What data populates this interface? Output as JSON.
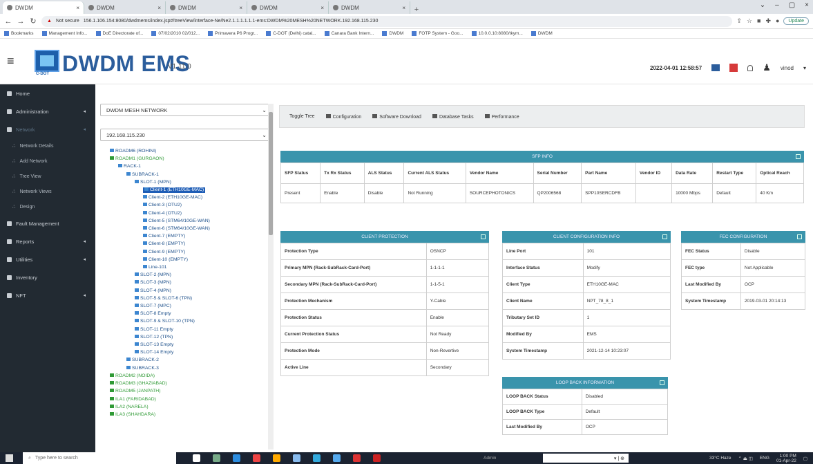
{
  "browser": {
    "tabs": [
      {
        "label": "DWDM",
        "active": true
      },
      {
        "label": "DWDM",
        "active": false
      },
      {
        "label": "DWDM",
        "active": false
      },
      {
        "label": "DWDM",
        "active": false
      },
      {
        "label": "DWDM",
        "active": false
      }
    ],
    "new_tab": "+",
    "address": {
      "security": "Not secure",
      "url": "156.1.106.154:8080/dwdmems/index.jsp#/treeView/interface-Ne/Ne2.1.1.1.1.1.1-ems:DWDM%20MESH%20NETWORK.192.168.115.230"
    },
    "update_label": "Update",
    "bookmarks": [
      "Bookmarks",
      "Management Info...",
      "DoE Directorate of...",
      "07/02/2010 02/012...",
      "Primavera P6 Progr...",
      "C-DOT (Delhi) catal...",
      "Canara Bank Intern...",
      "DWDM",
      "FOTP System - Goo...",
      "10.0.0.10:8080/tkym...",
      "DWDM"
    ]
  },
  "header": {
    "logo_text": "C-DOT",
    "brand": "DWDM EMS",
    "version": "V1.11.0",
    "datetime": "2022-04-01 12:58:57",
    "user": "vinod"
  },
  "sidebar": {
    "items": [
      {
        "label": "Home",
        "icon": "home-icon",
        "caret": false
      },
      {
        "label": "Administration",
        "icon": "admin-icon",
        "caret": true
      },
      {
        "label": "Network",
        "icon": "network-icon",
        "caret": true,
        "dim": true
      },
      {
        "label": "Network Details",
        "sub": true
      },
      {
        "label": "Add Network",
        "sub": true
      },
      {
        "label": "Tree View",
        "sub": true
      },
      {
        "label": "Network Views",
        "sub": true
      },
      {
        "label": "Design",
        "sub": true
      },
      {
        "label": "Fault Management",
        "icon": "bell-icon",
        "caret": false
      },
      {
        "label": "Reports",
        "icon": "reports-icon",
        "caret": true
      },
      {
        "label": "Utilities",
        "icon": "utilities-icon",
        "caret": true
      },
      {
        "label": "Inventory",
        "icon": "inventory-icon",
        "caret": false
      },
      {
        "label": "NFT",
        "icon": "nft-icon",
        "caret": true
      }
    ]
  },
  "tree_pane": {
    "network_select": "DWDM MESH NETWORK",
    "ip_select": "192.168.115.230",
    "nodes": [
      {
        "label": "ROADM6 (ROHINI)",
        "level": 0,
        "green": false
      },
      {
        "label": "ROADM1 (GURGAON)",
        "level": 0,
        "green": true
      },
      {
        "label": "RACK-1",
        "level": 1
      },
      {
        "label": "SUBRACK-1",
        "level": 2
      },
      {
        "label": "SLOT-1 (MPN)",
        "level": 3
      },
      {
        "label": "Client-1 (ETH10GE-MAC)",
        "level": 4,
        "selected": true
      },
      {
        "label": "Client-2 (ETH10GE-MAC)",
        "level": 4
      },
      {
        "label": "Client-3 (OTU2)",
        "level": 4
      },
      {
        "label": "Client-4 (OTU2)",
        "level": 4
      },
      {
        "label": "Client-5 (STM64/10GE-WAN)",
        "level": 4
      },
      {
        "label": "Client-6 (STM64/10GE-WAN)",
        "level": 4
      },
      {
        "label": "Client-7 (EMPTY)",
        "level": 4
      },
      {
        "label": "Client-8 (EMPTY)",
        "level": 4
      },
      {
        "label": "Client-9 (EMPTY)",
        "level": 4
      },
      {
        "label": "Client-10 (EMPTY)",
        "level": 4
      },
      {
        "label": "Line-101",
        "level": 4
      },
      {
        "label": "SLOT-2 (MPN)",
        "level": 3
      },
      {
        "label": "SLOT-3 (MPN)",
        "level": 3
      },
      {
        "label": "SLOT-4 (MPN)",
        "level": 3
      },
      {
        "label": "SLOT-5 & SLOT-6 (TPN)",
        "level": 3
      },
      {
        "label": "SLOT-7 (MPC)",
        "level": 3
      },
      {
        "label": "SLOT-8 Empty",
        "level": 3
      },
      {
        "label": "SLOT-9 & SLOT-10 (TPN)",
        "level": 3
      },
      {
        "label": "SLOT-11 Empty",
        "level": 3
      },
      {
        "label": "SLOT-12 (TPN)",
        "level": 3
      },
      {
        "label": "SLOT-13 Empty",
        "level": 3
      },
      {
        "label": "SLOT-14 Empty",
        "level": 3
      },
      {
        "label": "SUBRACK-2",
        "level": 2
      },
      {
        "label": "SUBRACK-3",
        "level": 2
      },
      {
        "label": "ROADM2 (NOIDA)",
        "level": 0,
        "green": true
      },
      {
        "label": "ROADM3 (GHAZIABAD)",
        "level": 0,
        "green": true
      },
      {
        "label": "ROADM5 (JANPATH)",
        "level": 0,
        "green": true
      },
      {
        "label": "ILA1 (FARIDABAD)",
        "level": 0,
        "green": true
      },
      {
        "label": "ILA2 (NARELA)",
        "level": 0,
        "green": true
      },
      {
        "label": "ILA3 (SHAHDARA)",
        "level": 0,
        "green": true
      }
    ]
  },
  "toolbar": {
    "items": [
      "Toggle Tree",
      "Configuration",
      "Software Download",
      "Database Tasks",
      "Performance"
    ]
  },
  "sfp_info": {
    "title": "SFP INFO",
    "headers": [
      "SFP Status",
      "Tx Rx Status",
      "ALS Status",
      "Current ALS Status",
      "Vendor Name",
      "Serial Number",
      "Part Name",
      "Vendor ID",
      "Data Rate",
      "Restart Type",
      "Optical Reach"
    ],
    "row": [
      "Present",
      "Enable",
      "Disable",
      "Not Running",
      "SOURCEPHOTONICS",
      "QP2006568",
      "SPP10SERCDFB",
      "",
      "10000 Mbps",
      "Default",
      "40 Km"
    ]
  },
  "client_protection": {
    "title": "CLIENT PROTECTION",
    "rows": [
      [
        "Protection Type",
        "OSNCP"
      ],
      [
        "Primary MPN (Rack-SubRack-Card-Port)",
        "1-1-1-1"
      ],
      [
        "Secondary MPN (Rack-SubRack-Card-Port)",
        "1-1-5-1"
      ],
      [
        "Protection Mechanism",
        "Y-Cable"
      ],
      [
        "Protection Status",
        "Enable"
      ],
      [
        "Current Protection Status",
        "Not Ready"
      ],
      [
        "Protection Mode",
        "Non-Revertive"
      ],
      [
        "Active Line",
        "Secondary"
      ]
    ]
  },
  "client_config": {
    "title": "CLIENT CONFIGURATION INFO",
    "rows": [
      [
        "Line Port",
        "101"
      ],
      [
        "Interface Status",
        "Modify"
      ],
      [
        "Client Type",
        "ETH10GE-MAC"
      ],
      [
        "Client Name",
        "NPT_78_8_1"
      ],
      [
        "Tributary Set ID",
        "1"
      ],
      [
        "Modified By",
        "EMS"
      ],
      [
        "System Timestamp",
        "2021-12-14 10:23:07"
      ]
    ]
  },
  "fec_config": {
    "title": "FEC CONFIGURATION",
    "rows": [
      [
        "FEC Status",
        "Disable"
      ],
      [
        "FEC type",
        "Not Applicable"
      ],
      [
        "Last Modified By",
        "OCP"
      ],
      [
        "System Timestamp",
        "2019-03-01 20:14:13"
      ]
    ]
  },
  "loopback": {
    "title": "LOOP BACK INFORMATION",
    "rows": [
      [
        "LOOP BACK Status",
        "Disabled"
      ],
      [
        "LOOP BACK Type",
        "Default"
      ],
      [
        "Last Modified By",
        "OCP"
      ]
    ]
  },
  "taskbar": {
    "search_placeholder": "Type here to search",
    "admin_label": "Admin",
    "weather": "33°C Haze",
    "lang": "ENG",
    "time": "1:00 PM",
    "date": "01-Apr-22"
  },
  "colors": {
    "panel_header": "#3a94ac",
    "sidebar_bg": "#222a32",
    "brand": "#2b5d9c",
    "tree_green": "#2f9a35"
  }
}
